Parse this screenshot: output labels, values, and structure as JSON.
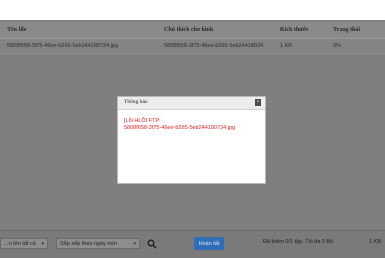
{
  "table": {
    "columns": [
      "Tên file",
      "Chú thích cho hình",
      "Kích thước",
      "Trạng thái"
    ],
    "rows": [
      [
        "5808f658-3f75-46ee-b265-5eb244180734.jpg",
        "5808f658-3f75-46ee-b265-5eb24418034",
        "1 KB",
        "0%"
      ]
    ]
  },
  "dialog": {
    "title": "Thông báo",
    "close_glyph": "×",
    "message_line1": "[Lỗi HLỖI FTP:",
    "message_line2": "5808f658-3f75-46ee-b265-5eb244180734.jpg"
  },
  "footer": {
    "filter_select": "...o tên tất cả",
    "sort_select": "Sắp xếp theo ngày mới",
    "complete_button": "Hoàn tất",
    "summary": "Đã thêm 0/1 tập. Tối đa 0 Bộ",
    "size": "1 KB"
  },
  "colors": {
    "error_text": "#e02020",
    "primary_button": "#2d6eb6"
  }
}
